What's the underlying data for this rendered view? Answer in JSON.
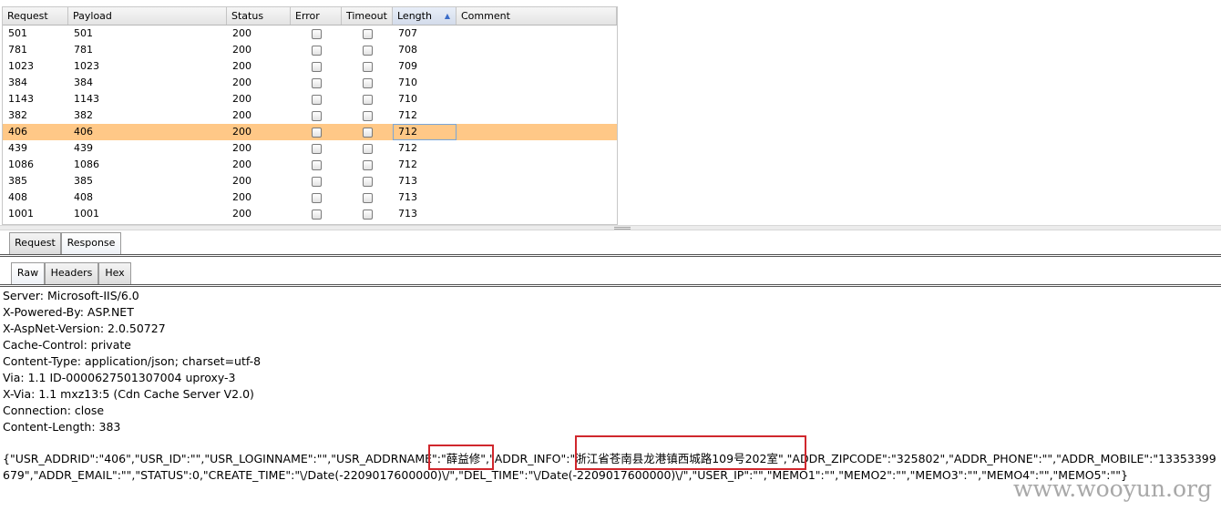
{
  "table": {
    "columns": [
      "Request",
      "Payload",
      "Status",
      "Error",
      "Timeout",
      "Length",
      "Comment"
    ],
    "sorted_column": "Length",
    "sort_direction": "ascending",
    "selected_row": 6,
    "rows": [
      {
        "request": "501",
        "payload": "501",
        "status": "200",
        "error": false,
        "timeout": false,
        "length": "707",
        "comment": ""
      },
      {
        "request": "781",
        "payload": "781",
        "status": "200",
        "error": false,
        "timeout": false,
        "length": "708",
        "comment": ""
      },
      {
        "request": "1023",
        "payload": "1023",
        "status": "200",
        "error": false,
        "timeout": false,
        "length": "709",
        "comment": ""
      },
      {
        "request": "384",
        "payload": "384",
        "status": "200",
        "error": false,
        "timeout": false,
        "length": "710",
        "comment": ""
      },
      {
        "request": "1143",
        "payload": "1143",
        "status": "200",
        "error": false,
        "timeout": false,
        "length": "710",
        "comment": ""
      },
      {
        "request": "382",
        "payload": "382",
        "status": "200",
        "error": false,
        "timeout": false,
        "length": "712",
        "comment": ""
      },
      {
        "request": "406",
        "payload": "406",
        "status": "200",
        "error": false,
        "timeout": false,
        "length": "712",
        "comment": ""
      },
      {
        "request": "439",
        "payload": "439",
        "status": "200",
        "error": false,
        "timeout": false,
        "length": "712",
        "comment": ""
      },
      {
        "request": "1086",
        "payload": "1086",
        "status": "200",
        "error": false,
        "timeout": false,
        "length": "712",
        "comment": ""
      },
      {
        "request": "385",
        "payload": "385",
        "status": "200",
        "error": false,
        "timeout": false,
        "length": "713",
        "comment": ""
      },
      {
        "request": "408",
        "payload": "408",
        "status": "200",
        "error": false,
        "timeout": false,
        "length": "713",
        "comment": ""
      },
      {
        "request": "1001",
        "payload": "1001",
        "status": "200",
        "error": false,
        "timeout": false,
        "length": "713",
        "comment": ""
      }
    ]
  },
  "tabs": {
    "request": "Request",
    "response": "Response",
    "active": "Response"
  },
  "subtabs": {
    "raw": "Raw",
    "headers": "Headers",
    "hex": "Hex",
    "active": "Raw"
  },
  "response": {
    "headers": [
      "Server: Microsoft-IIS/6.0",
      "X-Powered-By: ASP.NET",
      "X-AspNet-Version: 2.0.50727",
      "Cache-Control: private",
      "Content-Type: application/json; charset=utf-8",
      "Via: 1.1 ID-0000627501307004 uproxy-3",
      "X-Via: 1.1 mxz13:5 (Cdn Cache Server V2.0)",
      "Connection: close",
      "Content-Length: 383"
    ],
    "body": "{\"USR_ADDRID\":\"406\",\"USR_ID\":\"\",\"USR_LOGINNAME\":\"\",\"USR_ADDRNAME\":\"薛益修\",\"ADDR_INFO\":\"浙江省苍南县龙港镇西城路109号202室\",\"ADDR_ZIPCODE\":\"325802\",\"ADDR_PHONE\":\"\",\"ADDR_MOBILE\":\"13353399679\",\"ADDR_EMAIL\":\"\",\"STATUS\":0,\"CREATE_TIME\":\"\\/Date(-2209017600000)\\/\",\"DEL_TIME\":\"\\/Date(-2209017600000)\\/\",\"USER_IP\":\"\",\"MEMO1\":\"\",\"MEMO2\":\"\",\"MEMO3\":\"\",\"MEMO4\":\"\",\"MEMO5\":\"\"}"
  },
  "highlight_color": "#d0272d",
  "selection_color": "#ffc887",
  "watermark": "www.wooyun.org"
}
